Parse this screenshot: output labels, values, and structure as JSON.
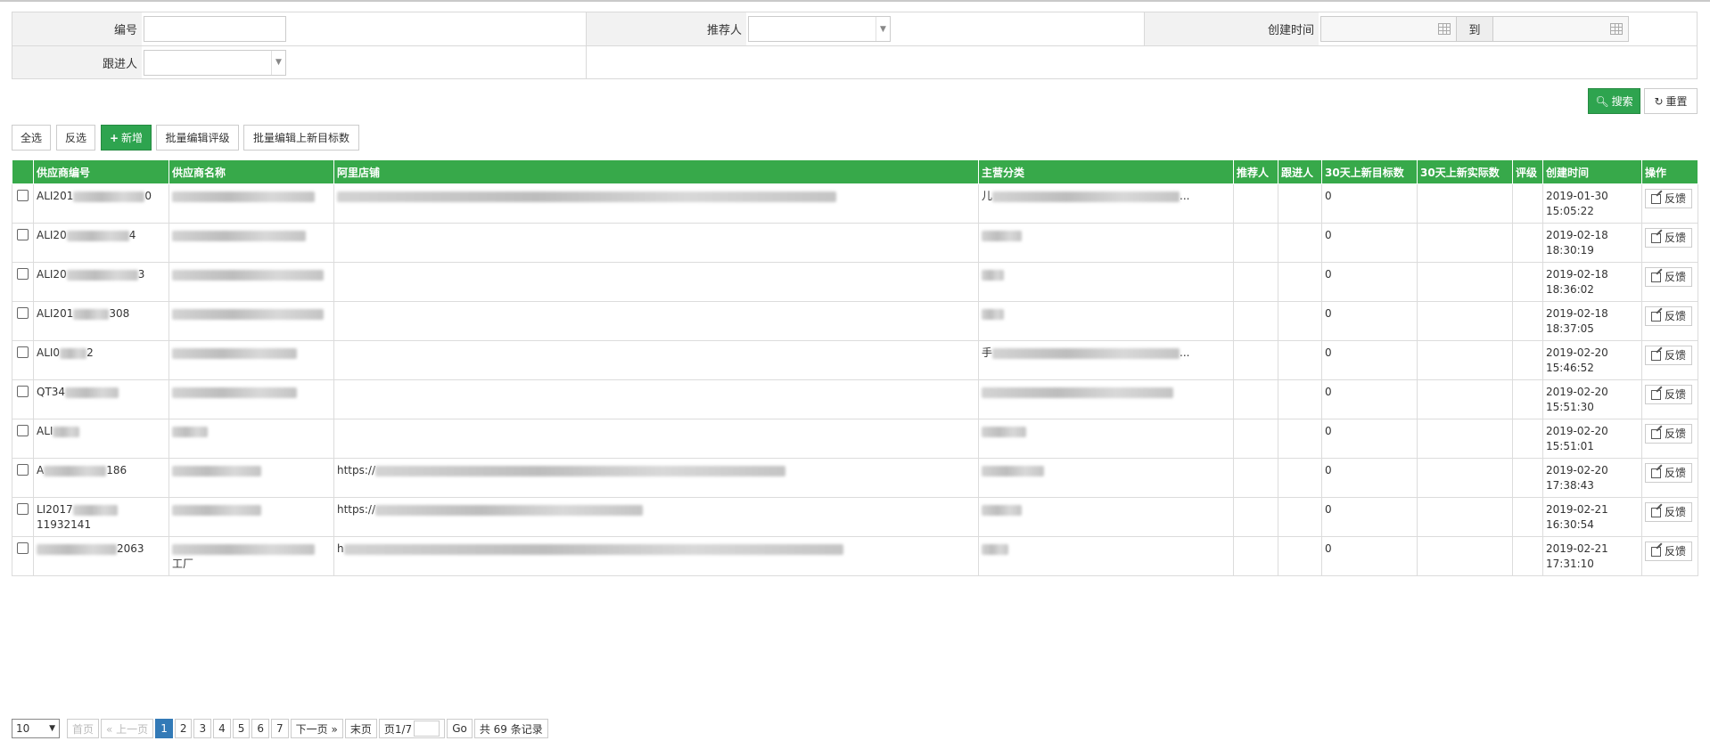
{
  "filter": {
    "id_label": "编号",
    "referrer_label": "推荐人",
    "created_label": "创建时间",
    "to_label": "到",
    "follower_label": "跟进人"
  },
  "actions": {
    "search": "搜索",
    "reset": "重置"
  },
  "toolbar": {
    "select_all": "全选",
    "invert": "反选",
    "add": "新增",
    "batch_rating": "批量编辑评级",
    "batch_target": "批量编辑上新目标数"
  },
  "table": {
    "headers": [
      "供应商编号",
      "供应商名称",
      "阿里店铺",
      "主营分类",
      "推荐人",
      "跟进人",
      "30天上新目标数",
      "30天上新实际数",
      "评级",
      "创建时间",
      "操作"
    ],
    "feedback_label": "反馈",
    "rows": [
      {
        "id": "ALI201",
        "id_tail": "0",
        "name": "",
        "shop": "",
        "category": "儿",
        "cat_tail": "...",
        "target": "0",
        "date": "2019-01-30",
        "time": "15:05:22"
      },
      {
        "id": "ALI20",
        "id_tail": "4",
        "name": "",
        "shop": "",
        "category": "",
        "cat_tail": "",
        "target": "0",
        "date": "2019-02-18",
        "time": "18:30:19"
      },
      {
        "id": "ALI20",
        "id_tail": "3",
        "name": "",
        "shop": "",
        "category": "",
        "cat_tail": "",
        "target": "0",
        "date": "2019-02-18",
        "time": "18:36:02"
      },
      {
        "id": "ALI201",
        "id_tail": "308",
        "name": "",
        "shop": "",
        "category": "",
        "cat_tail": "",
        "target": "0",
        "date": "2019-02-18",
        "time": "18:37:05"
      },
      {
        "id": "ALI0",
        "id_tail": "2",
        "name": "",
        "shop": "",
        "category": "手",
        "cat_tail": "...",
        "target": "0",
        "date": "2019-02-20",
        "time": "15:46:52"
      },
      {
        "id": "QT34",
        "id_tail": "",
        "name": "",
        "shop": "",
        "category": "",
        "cat_tail": "",
        "target": "0",
        "date": "2019-02-20",
        "time": "15:51:30"
      },
      {
        "id": "ALI",
        "id_tail": "",
        "name": "",
        "shop": "",
        "category": "",
        "cat_tail": "",
        "target": "0",
        "date": "2019-02-20",
        "time": "15:51:01"
      },
      {
        "id": "A",
        "id_tail": "186",
        "name": "",
        "shop": "https://",
        "category": "",
        "cat_tail": "",
        "target": "0",
        "date": "2019-02-20",
        "time": "17:38:43"
      },
      {
        "id": "LI2017",
        "id_tail": "11932141",
        "name": "",
        "shop": "https://",
        "category": "",
        "cat_tail": "",
        "target": "0",
        "date": "2019-02-21",
        "time": "16:30:54"
      },
      {
        "id": "",
        "id_tail": "2063",
        "name": "",
        "name_tail": "工厂",
        "shop": "h",
        "category": "",
        "cat_tail": "",
        "target": "0",
        "date": "2019-02-21",
        "time": "17:31:10"
      }
    ]
  },
  "pager": {
    "page_size": "10",
    "first": "首页",
    "prev": "« 上一页",
    "pages": [
      "1",
      "2",
      "3",
      "4",
      "5",
      "6",
      "7"
    ],
    "current": "1",
    "next": "下一页 »",
    "last": "末页",
    "page_of": "页1/7",
    "go": "Go",
    "total": "共 69 条记录"
  }
}
